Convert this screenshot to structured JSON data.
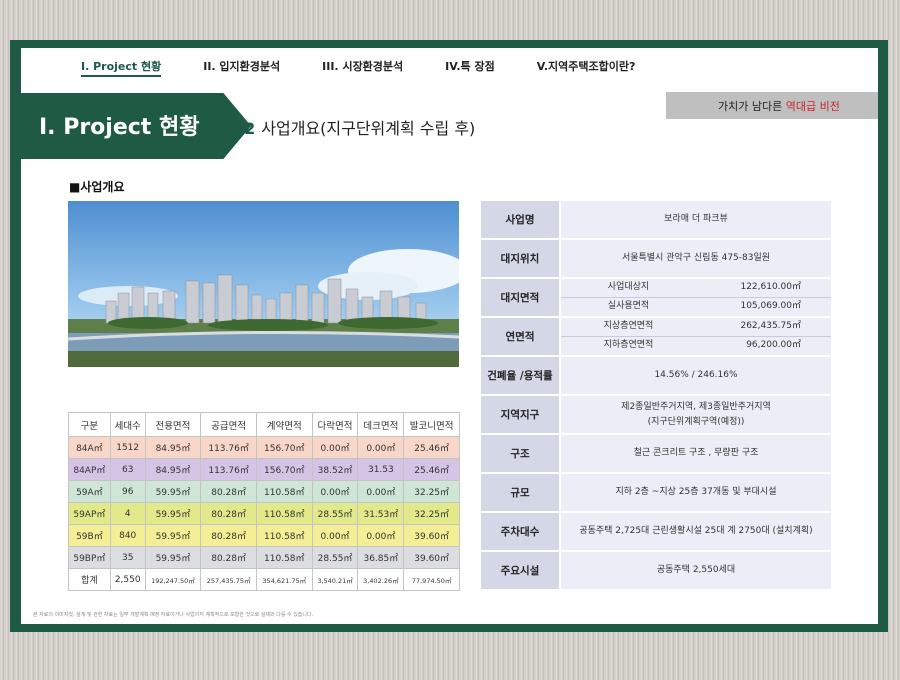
{
  "nav": {
    "items": [
      {
        "label": "I. Project 현황",
        "active": true
      },
      {
        "label": "II. 입지환경분석",
        "active": false
      },
      {
        "label": "III. 시장환경분석",
        "active": false
      },
      {
        "label": "IV.특 장점",
        "active": false
      },
      {
        "label": "V.지역주택조합이란?",
        "active": false
      }
    ]
  },
  "header": {
    "title": "I. Project 현황",
    "section_number": "02",
    "section_title": "사업개요(지구단위계획 수립 후)",
    "vision_prefix": "가치가 남다른 ",
    "vision_highlight": "역대급 비전"
  },
  "section_label": "■사업개요",
  "unit_table": {
    "headers": [
      "구분",
      "세대수",
      "전용면적",
      "공급면적",
      "계약면적",
      "다락면적",
      "데크면적",
      "발코니면적"
    ],
    "rows": [
      {
        "cells": [
          "84A㎡",
          "1512",
          "84.95㎡",
          "113.76㎡",
          "156.70㎡",
          "0.00㎡",
          "0.00㎡",
          "25.46㎡"
        ],
        "color": "#f8d7c8"
      },
      {
        "cells": [
          "84AP㎡",
          "63",
          "84.95㎡",
          "113.76㎡",
          "156.70㎡",
          "38.52㎡",
          "31.53",
          "25.46㎡"
        ],
        "color": "#d6c4e6"
      },
      {
        "cells": [
          "59A㎡",
          "96",
          "59.95㎡",
          "80.28㎡",
          "110.58㎡",
          "0.00㎡",
          "0.00㎡",
          "32.25㎡"
        ],
        "color": "#cfe6d6"
      },
      {
        "cells": [
          "59AP㎡",
          "4",
          "59.95㎡",
          "80.28㎡",
          "110.58㎡",
          "28.55㎡",
          "31.53㎡",
          "32.25㎡"
        ],
        "color": "#e1e98a"
      },
      {
        "cells": [
          "59B㎡",
          "840",
          "59.95㎡",
          "80.28㎡",
          "110.58㎡",
          "0.00㎡",
          "0.00㎡",
          "39.60㎡"
        ],
        "color": "#f4ee96"
      },
      {
        "cells": [
          "59BP㎡",
          "35",
          "59.95㎡",
          "80.28㎡",
          "110.58㎡",
          "28.55㎡",
          "36.85㎡",
          "39.60㎡"
        ],
        "color": "#dcdde1"
      }
    ],
    "total": [
      "합계",
      "2,550",
      "192,247.50㎡",
      "257,435.75㎡",
      "354,621.75㎡",
      "3,540.21㎡",
      "3,402.26㎡",
      "77,974.50㎡"
    ]
  },
  "info": {
    "business_name_label": "사업명",
    "business_name": "보라매 더 파크뷰",
    "location_label": "대지위치",
    "location": "서울특별시 관악구 신림동 475-83일원",
    "site_area_label": "대지면적",
    "site_area": [
      {
        "k": "사업대상지",
        "v": "122,610.00㎡"
      },
      {
        "k": "실사용면적",
        "v": "105,069.00㎡"
      }
    ],
    "floor_area_label": "연면적",
    "floor_area": [
      {
        "k": "지상층연면적",
        "v": "262,435.75㎡"
      },
      {
        "k": "지하층연면적",
        "v": "96,200.00㎡"
      }
    ],
    "ratio_label": "건폐율 /용적률",
    "ratio": "14.56% / 246.16%",
    "zone_label": "지역지구",
    "zone_line1": "제2종일반주거지역, 제3종일반주거지역",
    "zone_line2": "(지구단위계획구역(예정))",
    "structure_label": "구조",
    "structure": "철근 콘크리트 구조 , 무량판 구조",
    "scale_label": "규모",
    "scale": "지하 2층 ~지상 25층 37개동 및 부대시설",
    "parking_label": "주차대수",
    "parking": "공동주택 2,725대 근린생활시설 25대 계 2750대 (설치계획)",
    "facilities_label": "주요시설",
    "facilities": "공동주택 2,550세대"
  },
  "footnote": "본 자료의 이미지컷, 설계 및 관련 자료는 일부 개발계획 예정 자료이거나 사업이지 계획적으로 포함한 것으로 실제와 다를 수 있습니다.",
  "colors": {
    "brand_green": "#1e5a44",
    "highlight_red": "#c8242c",
    "label_bg": "#d4d7e6",
    "value_bg": "#eceef7"
  }
}
